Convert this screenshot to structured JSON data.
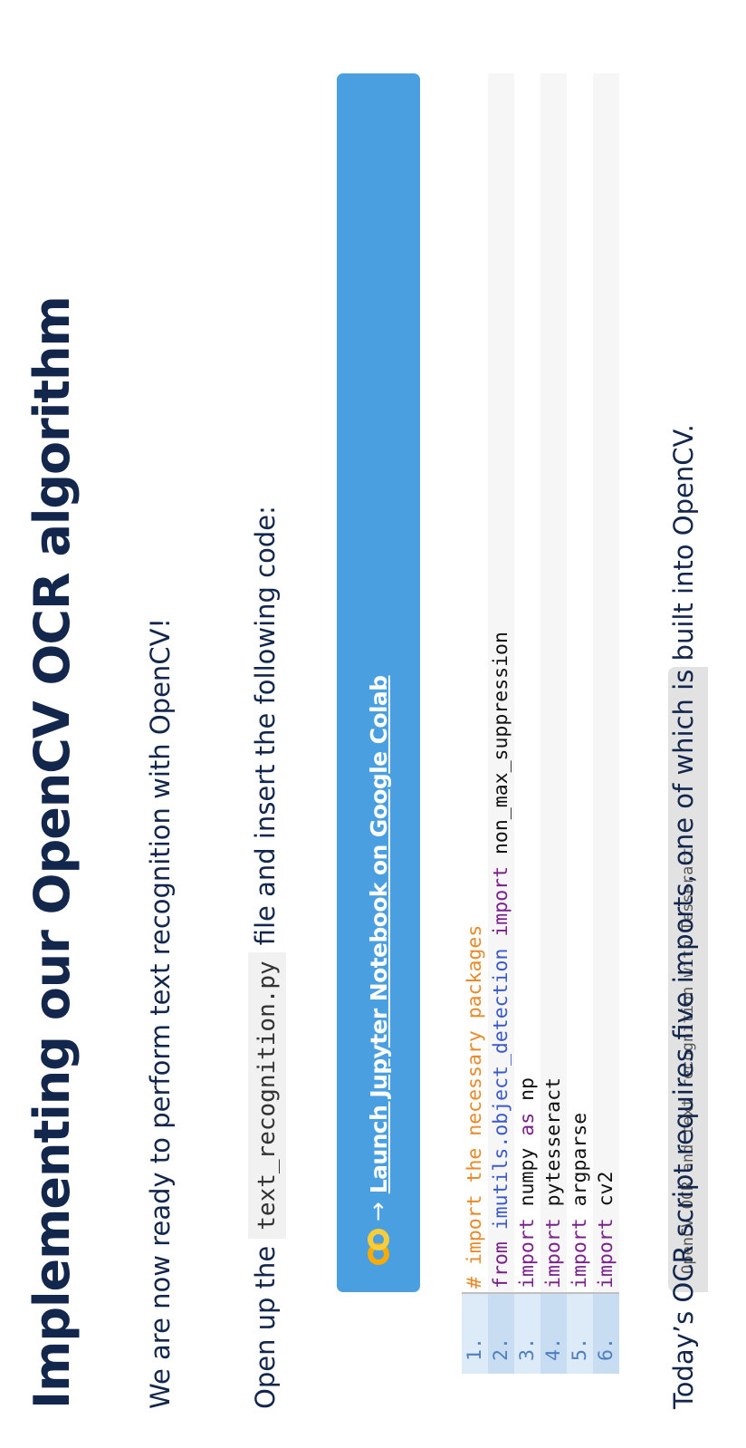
{
  "heading": "Implementing our OpenCV OCR algorithm",
  "intro": "We are now ready to perform text recognition with OpenCV!",
  "instruction": {
    "before": "Open up the",
    "filename": "text_recognition.py",
    "after": "file and insert the following code:"
  },
  "colab": {
    "arrow": "→",
    "link_label": "Launch Jupyter Notebook on Google Colab",
    "logo_icon": "colab-logo-icon",
    "bar_color": "#4a9fe0"
  },
  "code": {
    "tab_title": "OpenCV OCR and text recognition with Tesseract",
    "lines": [
      {
        "num": "1.",
        "tokens": [
          {
            "t": "# import the necessary packages",
            "c": "cm"
          }
        ]
      },
      {
        "num": "2.",
        "tokens": [
          {
            "t": "from",
            "c": "kw"
          },
          {
            "t": " ",
            "c": "plain"
          },
          {
            "t": "imutils.object_detection",
            "c": "mod"
          },
          {
            "t": " ",
            "c": "plain"
          },
          {
            "t": "import",
            "c": "kw"
          },
          {
            "t": " non_max_suppression",
            "c": "plain"
          }
        ]
      },
      {
        "num": "3.",
        "tokens": [
          {
            "t": "import",
            "c": "kw"
          },
          {
            "t": " numpy ",
            "c": "plain"
          },
          {
            "t": "as",
            "c": "kw"
          },
          {
            "t": " np",
            "c": "plain"
          }
        ]
      },
      {
        "num": "4.",
        "tokens": [
          {
            "t": "import",
            "c": "kw"
          },
          {
            "t": " pytesseract",
            "c": "plain"
          }
        ]
      },
      {
        "num": "5.",
        "tokens": [
          {
            "t": "import",
            "c": "kw"
          },
          {
            "t": " argparse",
            "c": "plain"
          }
        ]
      },
      {
        "num": "6.",
        "tokens": [
          {
            "t": "import",
            "c": "kw"
          },
          {
            "t": " cv2",
            "c": "plain"
          }
        ]
      }
    ]
  },
  "closing": "Today’s OCR script requires five imports, one of which is built into OpenCV.",
  "colors": {
    "heading": "#13264c",
    "keyword": "#7a1f8b",
    "comment": "#e8892a",
    "module": "#3b59c9",
    "line_number": "#4f7fbf"
  }
}
